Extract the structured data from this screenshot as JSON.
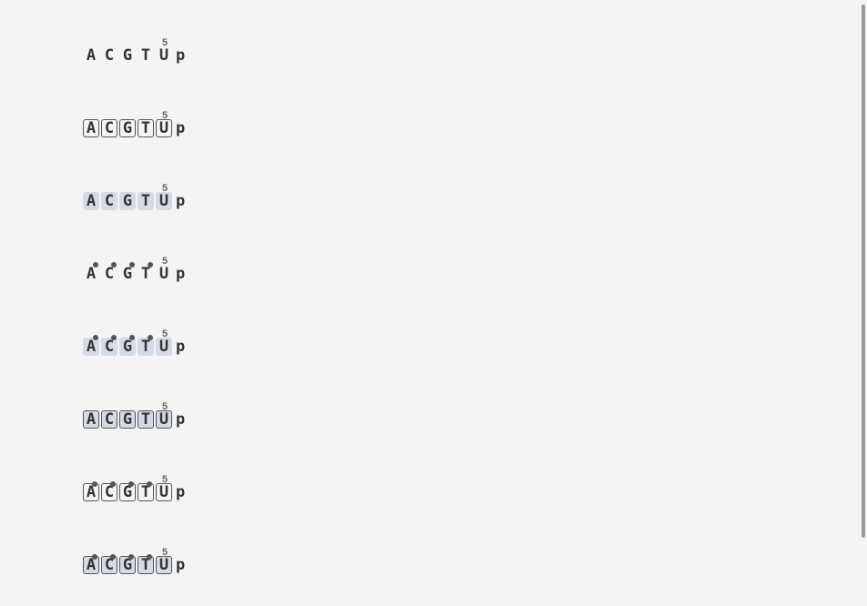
{
  "position_label": "5",
  "bases": [
    "A",
    "C",
    "G",
    "T",
    "U"
  ],
  "suffix": "p",
  "rows": [
    {
      "style": "plain",
      "dotted": [
        false,
        false,
        false,
        false,
        false
      ],
      "highlighted": [
        false,
        false,
        false,
        false,
        false
      ]
    },
    {
      "style": "outlined",
      "dotted": [
        false,
        false,
        false,
        false,
        false
      ],
      "highlighted": [
        false,
        false,
        false,
        false,
        false
      ]
    },
    {
      "style": "plain",
      "dotted": [
        false,
        false,
        false,
        false,
        false
      ],
      "highlighted": [
        true,
        true,
        true,
        true,
        true
      ]
    },
    {
      "style": "plain",
      "dotted": [
        true,
        true,
        true,
        true,
        false
      ],
      "highlighted": [
        false,
        false,
        false,
        false,
        false
      ]
    },
    {
      "style": "plain",
      "dotted": [
        true,
        true,
        true,
        true,
        false
      ],
      "highlighted": [
        true,
        true,
        true,
        true,
        true
      ]
    },
    {
      "style": "outlined",
      "dotted": [
        false,
        false,
        false,
        false,
        false
      ],
      "highlighted": [
        true,
        true,
        true,
        true,
        true
      ]
    },
    {
      "style": "outlined",
      "dotted": [
        true,
        true,
        true,
        true,
        false
      ],
      "highlighted": [
        false,
        false,
        false,
        false,
        false
      ]
    },
    {
      "style": "outlined",
      "dotted": [
        true,
        true,
        true,
        true,
        false
      ],
      "highlighted": [
        true,
        true,
        true,
        true,
        true
      ]
    }
  ]
}
